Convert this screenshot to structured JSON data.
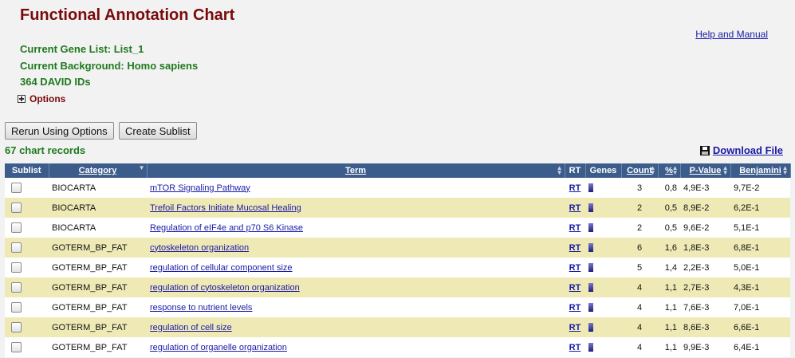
{
  "page": {
    "title": "Functional Annotation Chart",
    "help_link": "Help and Manual",
    "gene_list": "Current Gene List: List_1",
    "background": "Current Background: Homo sapiens",
    "david_ids": "364 DAVID IDs",
    "options_label": "Options"
  },
  "toolbar": {
    "rerun_label": "Rerun Using Options",
    "sublist_label": "Create Sublist"
  },
  "records_label": "67 chart records",
  "download_label": "Download File",
  "table": {
    "headers": {
      "sublist": "Sublist",
      "category": "Category",
      "term": "Term",
      "rt": "RT",
      "genes": "Genes",
      "count": "Count",
      "percent": "%",
      "pvalue": "P-Value",
      "benjamini": "Benjamini"
    },
    "rows": [
      {
        "category": "BIOCARTA",
        "term": "mTOR Signaling Pathway",
        "rt": "RT",
        "count": "3",
        "percent": "0,8",
        "pvalue": "4,9E-3",
        "benjamini": "9,7E-2"
      },
      {
        "category": "BIOCARTA",
        "term": "Trefoil Factors Initiate Mucosal Healing",
        "rt": "RT",
        "count": "2",
        "percent": "0,5",
        "pvalue": "8,9E-2",
        "benjamini": "6,2E-1"
      },
      {
        "category": "BIOCARTA",
        "term": "Regulation of eIF4e and p70 S6 Kinase",
        "rt": "RT",
        "count": "2",
        "percent": "0,5",
        "pvalue": "9,6E-2",
        "benjamini": "5,1E-1"
      },
      {
        "category": "GOTERM_BP_FAT",
        "term": "cytoskeleton organization",
        "rt": "RT",
        "count": "6",
        "percent": "1,6",
        "pvalue": "1,8E-3",
        "benjamini": "6,8E-1"
      },
      {
        "category": "GOTERM_BP_FAT",
        "term": "regulation of cellular component size",
        "rt": "RT",
        "count": "5",
        "percent": "1,4",
        "pvalue": "2,2E-3",
        "benjamini": "5,0E-1"
      },
      {
        "category": "GOTERM_BP_FAT",
        "term": "regulation of cytoskeleton organization",
        "rt": "RT",
        "count": "4",
        "percent": "1,1",
        "pvalue": "2,7E-3",
        "benjamini": "4,3E-1"
      },
      {
        "category": "GOTERM_BP_FAT",
        "term": "response to nutrient levels",
        "rt": "RT",
        "count": "4",
        "percent": "1,1",
        "pvalue": "7,6E-3",
        "benjamini": "7,0E-1"
      },
      {
        "category": "GOTERM_BP_FAT",
        "term": "regulation of cell size",
        "rt": "RT",
        "count": "4",
        "percent": "1,1",
        "pvalue": "8,6E-3",
        "benjamini": "6,6E-1"
      },
      {
        "category": "GOTERM_BP_FAT",
        "term": "regulation of organelle organization",
        "rt": "RT",
        "count": "4",
        "percent": "1,1",
        "pvalue": "9,9E-3",
        "benjamini": "6,4E-1"
      }
    ]
  },
  "colors": {
    "title": "#7a0b0b",
    "green_text": "#1f7a1f",
    "header_bg": "#3c5d8c",
    "alt_row": "#efeab5",
    "link": "#1a1aa6"
  }
}
